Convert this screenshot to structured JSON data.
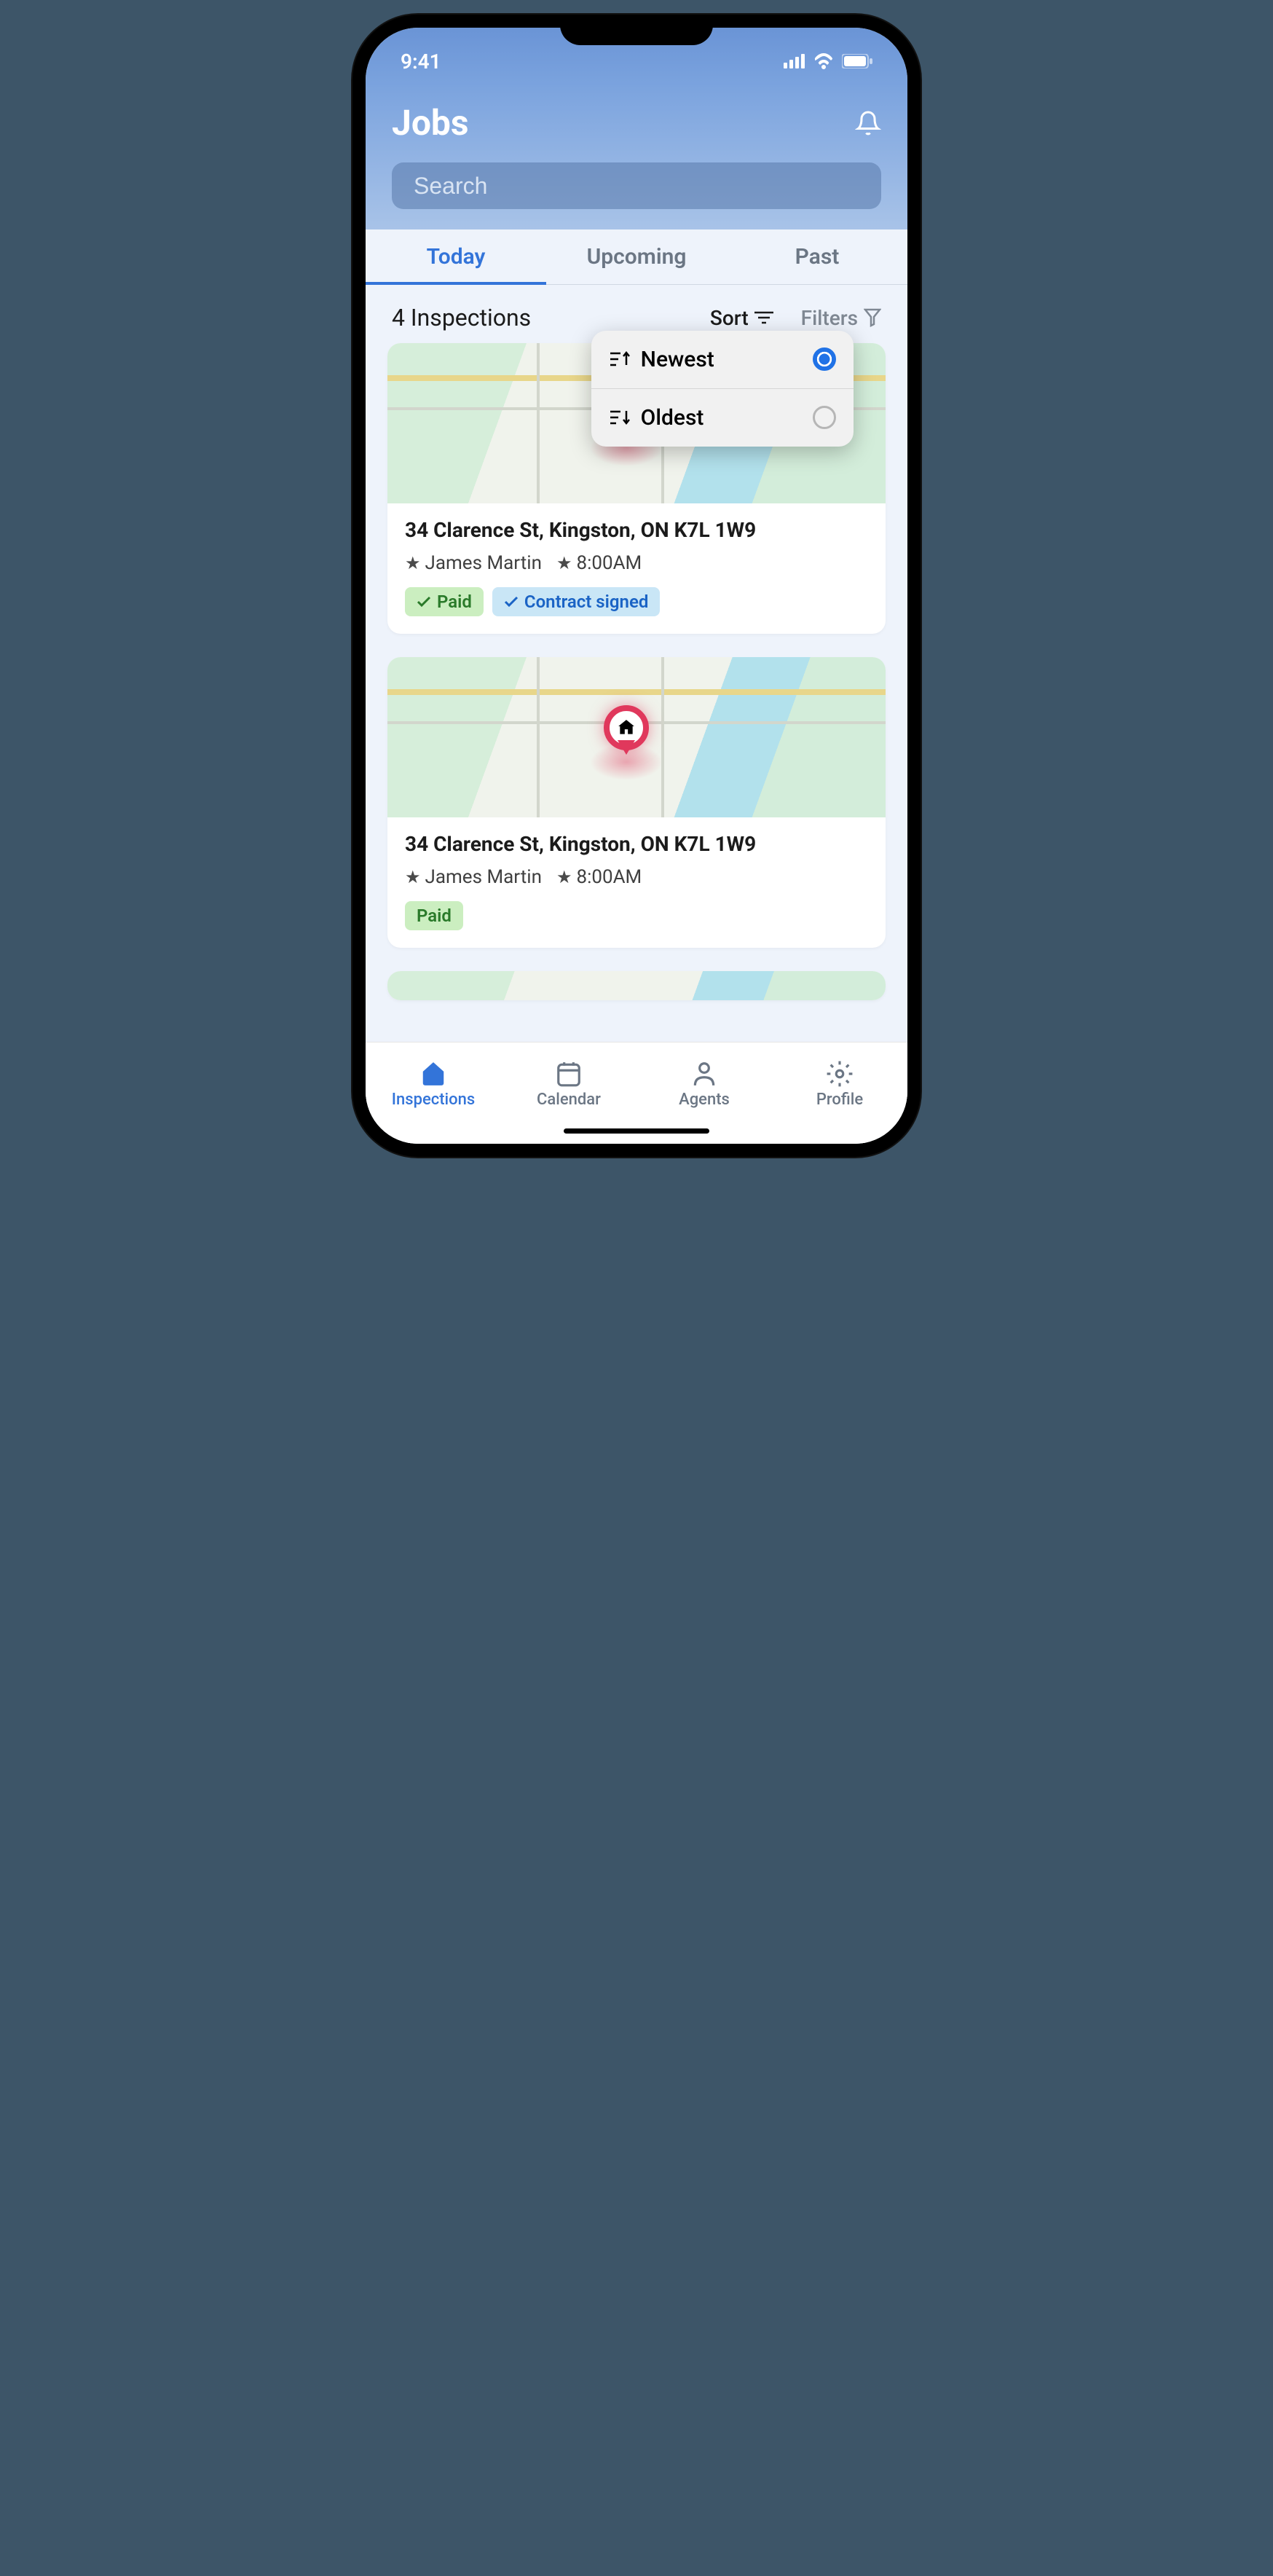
{
  "status": {
    "time": "9:41"
  },
  "header": {
    "title": "Jobs",
    "search_placeholder": "Search"
  },
  "tabs": [
    {
      "label": "Today",
      "active": true
    },
    {
      "label": "Upcoming",
      "active": false
    },
    {
      "label": "Past",
      "active": false
    }
  ],
  "list": {
    "count_text": "4 Inspections",
    "sort_label": "Sort",
    "filter_label": "Filters",
    "sort_options": [
      {
        "label": "Newest",
        "selected": true
      },
      {
        "label": "Oldest",
        "selected": false
      }
    ]
  },
  "cards": [
    {
      "address": "34 Clarence St, Kingston, ON K7L 1W9",
      "agent": "James Martin",
      "time": "8:00AM",
      "badges": [
        {
          "text": "Paid",
          "type": "paid",
          "has_check": true
        },
        {
          "text": "Contract signed",
          "type": "signed",
          "has_check": true
        }
      ]
    },
    {
      "address": "34 Clarence St, Kingston, ON K7L 1W9",
      "agent": "James Martin",
      "time": "8:00AM",
      "badges": [
        {
          "text": "Paid",
          "type": "paid",
          "has_check": false
        }
      ]
    }
  ],
  "nav": [
    {
      "label": "Inspections",
      "active": true,
      "icon": "house"
    },
    {
      "label": "Calendar",
      "active": false,
      "icon": "calendar"
    },
    {
      "label": "Agents",
      "active": false,
      "icon": "person"
    },
    {
      "label": "Profile",
      "active": false,
      "icon": "gear"
    }
  ]
}
